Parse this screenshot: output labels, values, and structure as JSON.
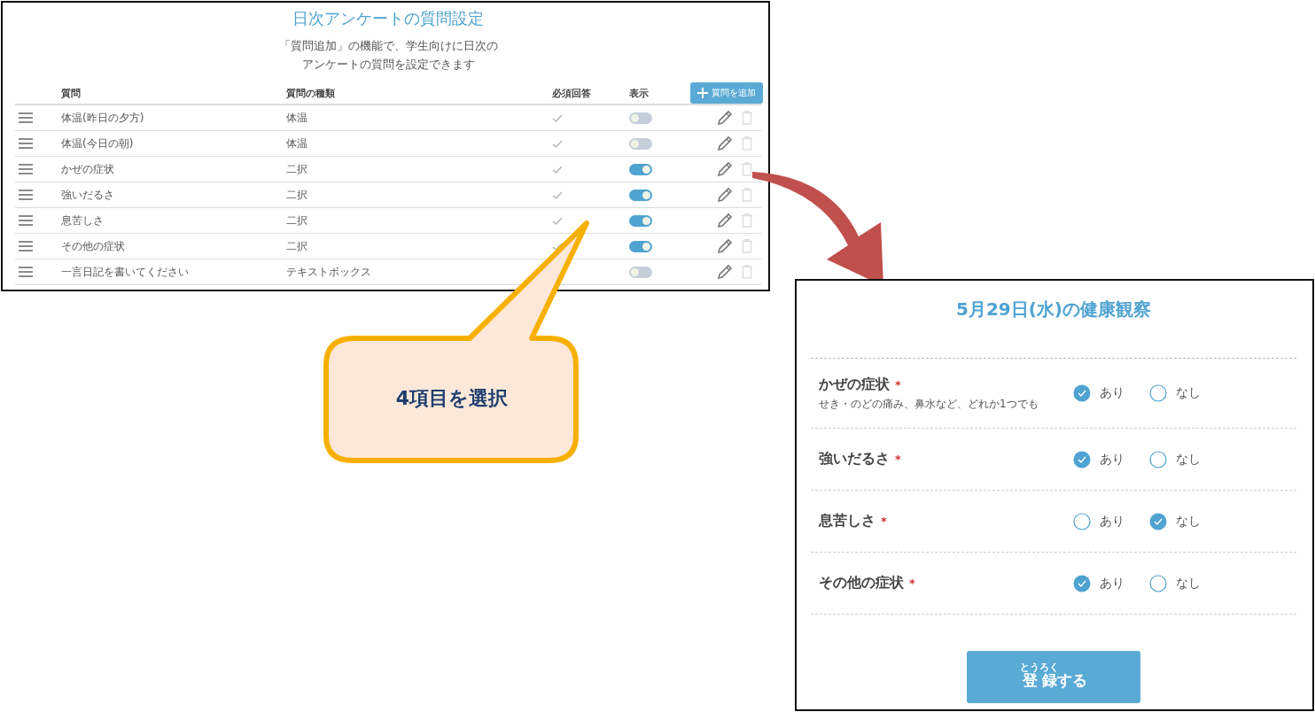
{
  "settings_panel": {
    "title": "日次アンケートの質問設定",
    "subtitle_lines": [
      "「質問追加」の機能で、学生向けに日次の",
      "アンケートの質問を設定できます"
    ],
    "columns": [
      "質問",
      "質問の種類",
      "必須回答",
      "表示"
    ],
    "add_button": {
      "label": "質問を追加"
    },
    "rows": [
      {
        "question": "体温(昨日の夕方)",
        "type": "体温",
        "required": true,
        "visible": false
      },
      {
        "question": "体温(今日の朝)",
        "type": "体温",
        "required": true,
        "visible": false
      },
      {
        "question": "かぜの症状",
        "type": "二択",
        "required": true,
        "visible": true
      },
      {
        "question": "強いだるさ",
        "type": "二択",
        "required": true,
        "visible": true
      },
      {
        "question": "息苦しさ",
        "type": "二択",
        "required": true,
        "visible": true
      },
      {
        "question": "その他の症状",
        "type": "二択",
        "required": true,
        "visible": true
      },
      {
        "question": "一言日記を書いてください",
        "type": "テキストボックス",
        "visible": false
      }
    ]
  },
  "callout": {
    "text": "4項目を選択"
  },
  "form_panel": {
    "title": "5月29日(水)の健康観察",
    "questions": [
      {
        "label": "かぜの症状",
        "required_mark": "*",
        "note": "せき・のどの痛み、鼻水など、どれか1つでも",
        "options": [
          {
            "label": "あり",
            "selected": true
          },
          {
            "label": "なし",
            "selected": false
          }
        ]
      },
      {
        "label": "強いだるさ",
        "required_mark": "*",
        "options": [
          {
            "label": "あり",
            "selected": true
          },
          {
            "label": "なし",
            "selected": false
          }
        ]
      },
      {
        "label": "息苦しさ",
        "required_mark": "*",
        "options": [
          {
            "label": "あり",
            "selected": false
          },
          {
            "label": "なし",
            "selected": true
          }
        ]
      },
      {
        "label": "その他の症状",
        "required_mark": "*",
        "options": [
          {
            "label": "あり",
            "selected": true
          },
          {
            "label": "なし",
            "selected": false
          }
        ]
      }
    ],
    "submit_button": {
      "base": "登録",
      "ruby": "とうろく",
      "rest": "する"
    }
  }
}
